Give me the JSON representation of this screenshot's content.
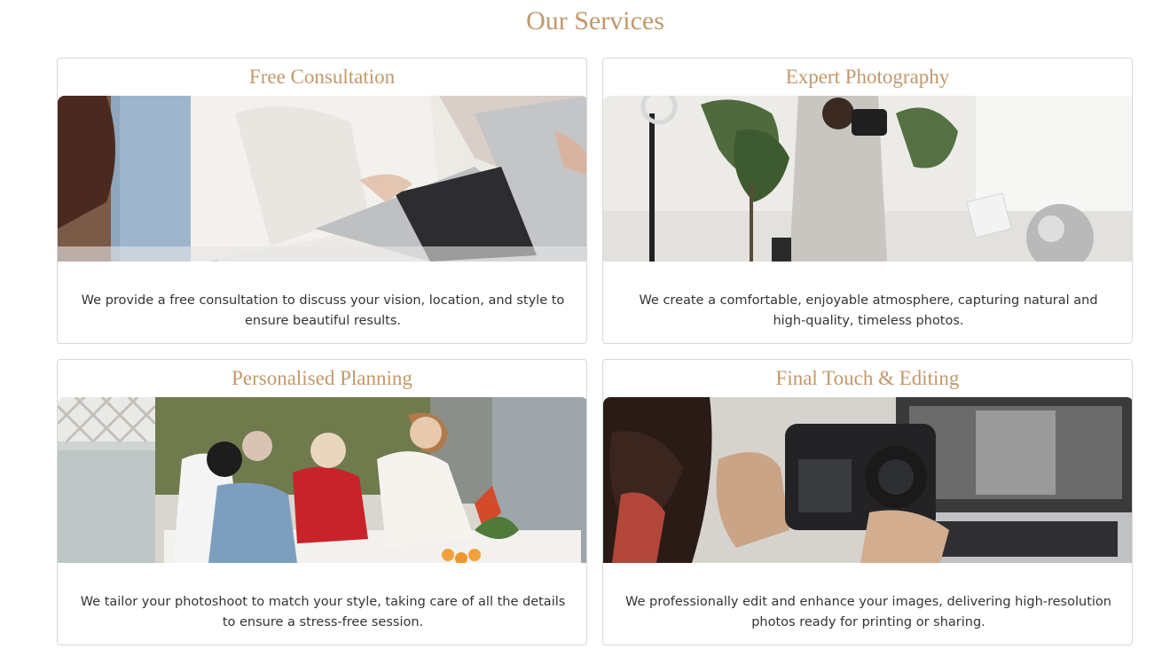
{
  "section": {
    "title": "Our Services"
  },
  "colors": {
    "accent": "#c2986a",
    "text": "#333333",
    "border": "#d8d8d8"
  },
  "services": [
    {
      "title": "Free Consultation",
      "description": "We provide a free consultation to discuss your vision, location, and style to ensure beautiful results."
    },
    {
      "title": "Expert Photography",
      "description": "We create a comfortable, enjoyable atmosphere, capturing natural and high-quality, timeless photos."
    },
    {
      "title": "Personalised Planning",
      "description": "We tailor your photoshoot to match your style, taking care of all the details to ensure a stress-free session."
    },
    {
      "title": "Final Touch & Editing",
      "description": "We professionally edit and enhance your images, delivering high-resolution photos ready for printing or sharing."
    }
  ]
}
